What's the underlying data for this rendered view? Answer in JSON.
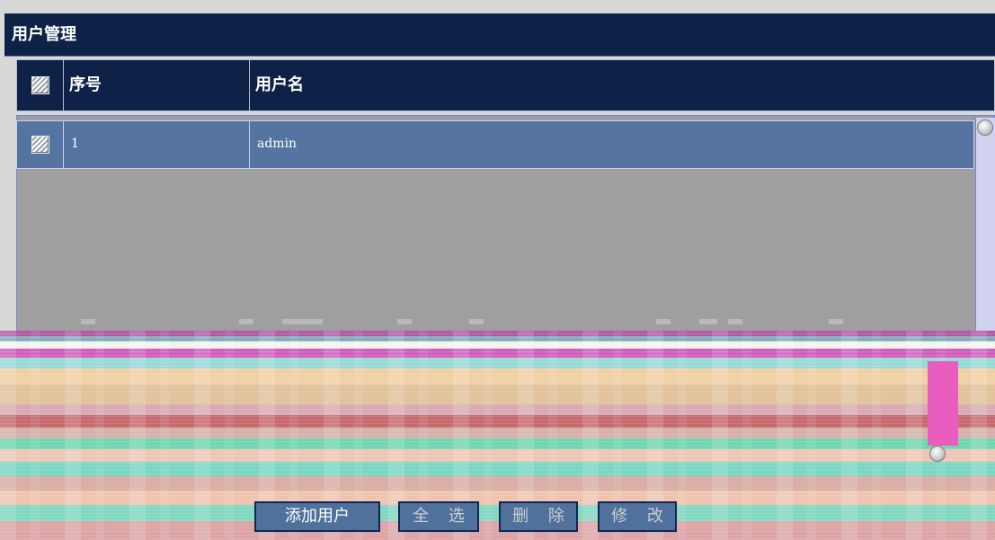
{
  "title": "用户管理",
  "table": {
    "headers": {
      "index": "序号",
      "username": "用户名"
    },
    "rows": [
      {
        "index": "1",
        "username": "admin"
      }
    ]
  },
  "buttons": {
    "add_user": "添加用户",
    "select_all": "全 选",
    "delete": "删 除",
    "edit": "修 改"
  },
  "colors": {
    "title_bg": "#0e2146",
    "row_bg": "#5574a2",
    "list_bg": "#9f9f9f"
  },
  "icons": {
    "header_checkbox": "checkbox-icon",
    "row_checkbox": "checkbox-icon",
    "scroll_up": "scroll-up-icon",
    "scroll_down": "scroll-down-icon"
  }
}
